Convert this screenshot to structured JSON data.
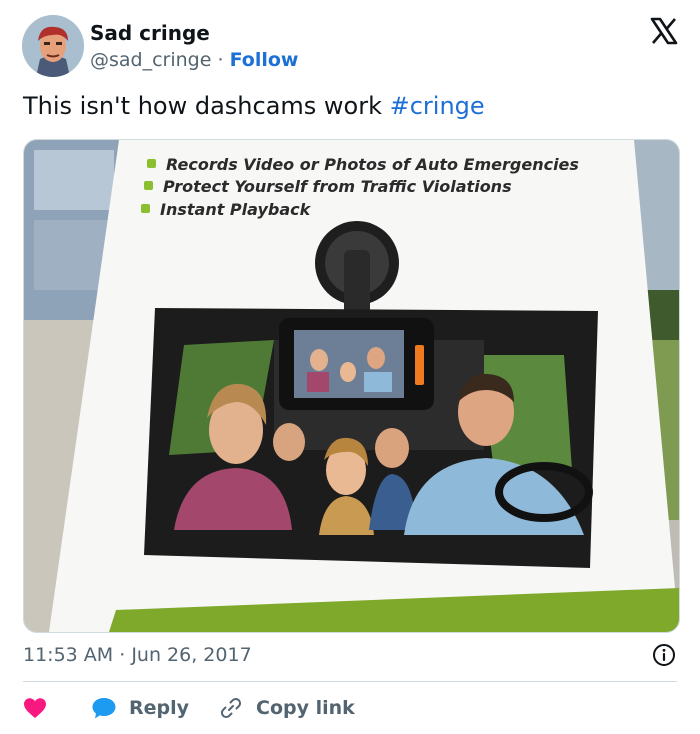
{
  "author": {
    "name": "Sad cringe",
    "handle": "@sad_cringe",
    "separator": "·",
    "follow_label": "Follow"
  },
  "icons": {
    "platform": "x-logo-icon",
    "info": "info-icon",
    "like": "heart-icon",
    "reply": "speech-bubble-icon",
    "copy": "link-icon"
  },
  "colors": {
    "accent": "#1d70d6",
    "like": "#f91880",
    "muted": "#536471"
  },
  "tweet": {
    "text": "This isn't how dashcams work ",
    "hashtag": "#cringe"
  },
  "media": {
    "box_features": [
      "Records Video or Photos of Auto Emergencies",
      "Protect Yourself from Traffic Violations",
      "Instant Playback"
    ]
  },
  "meta": {
    "time": "11:53 AM",
    "separator": "·",
    "date": "Jun 26, 2017"
  },
  "actions": {
    "reply_label": "Reply",
    "copy_label": "Copy link"
  }
}
